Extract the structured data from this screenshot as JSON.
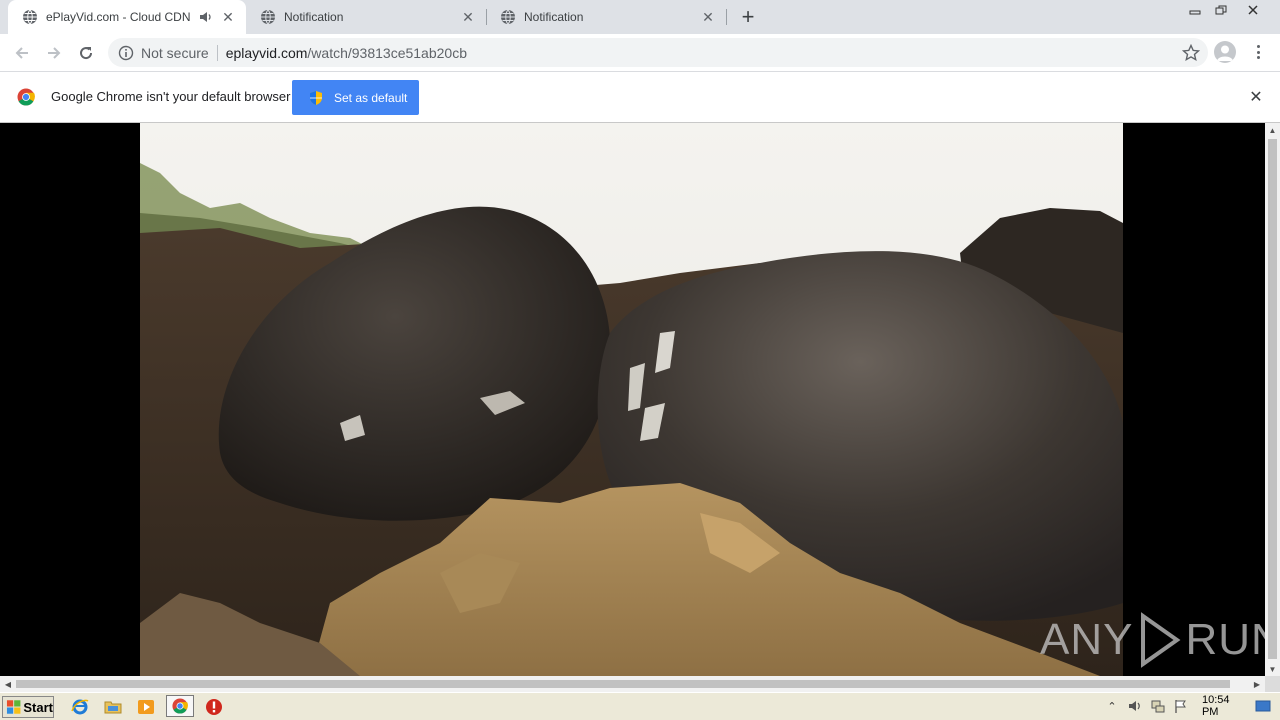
{
  "tabs": [
    {
      "title": "ePlayVid.com - Cloud CDN",
      "active": true,
      "audio": true
    },
    {
      "title": "Notification",
      "active": false,
      "audio": false
    },
    {
      "title": "Notification",
      "active": false,
      "audio": false
    }
  ],
  "address_bar": {
    "security_label": "Not secure",
    "host": "eplayvid.com",
    "path": "/watch/93813ce51ab20cb"
  },
  "infobar": {
    "message": "Google Chrome isn't your default browser",
    "button_label": "Set as default"
  },
  "watermark": {
    "left_text": "ANY",
    "right_text": "RUN"
  },
  "taskbar": {
    "start_label": "Start",
    "clock": "10:54 PM"
  },
  "colors": {
    "accent": "#4285f4",
    "tab_strip": "#dee1e6",
    "taskbar": "#ece9d8"
  }
}
